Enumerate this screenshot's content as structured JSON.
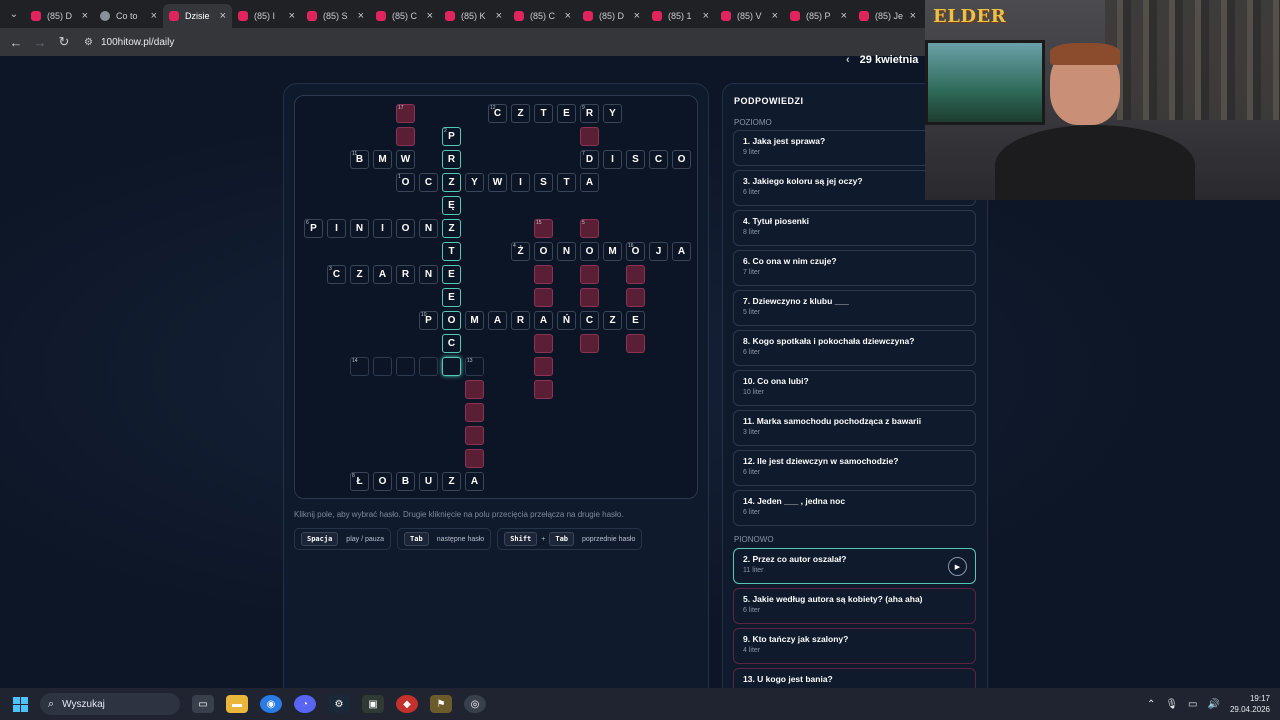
{
  "browser": {
    "tabs": [
      {
        "label": "(85) D",
        "fav": "youtube-icon"
      },
      {
        "label": "Co to",
        "fav": "gear-icon"
      },
      {
        "label": "Dzisie",
        "fav": "active-icon",
        "active": true
      },
      {
        "label": "(85) I",
        "fav": "youtube-icon"
      },
      {
        "label": "(85) S",
        "fav": "youtube-icon"
      },
      {
        "label": "(85) C",
        "fav": "youtube-icon"
      },
      {
        "label": "(85) K",
        "fav": "youtube-icon"
      },
      {
        "label": "(85) C",
        "fav": "youtube-icon"
      },
      {
        "label": "(85) D",
        "fav": "youtube-icon"
      },
      {
        "label": "(85) 1",
        "fav": "youtube-icon"
      },
      {
        "label": "(85) V",
        "fav": "youtube-icon"
      },
      {
        "label": "(85) P",
        "fav": "youtube-icon"
      },
      {
        "label": "(85) Je",
        "fav": "youtube-icon"
      }
    ],
    "url": "100hitow.pl/daily"
  },
  "header": {
    "date": "29 kwietnia",
    "prev_arrow": "‹"
  },
  "grid": {
    "letters": "CZTERY PR BMWR DISCO OCZYWISTA PINIONZ T ŻONOMOJA CZARNE E POMARAŃCZE C ŁOBUZA",
    "cells": [
      {
        "r": 0,
        "c": 4,
        "t": "",
        "red": true,
        "n": "17"
      },
      {
        "r": 0,
        "c": 8,
        "t": "C",
        "n": "12"
      },
      {
        "r": 0,
        "c": 9,
        "t": "Z"
      },
      {
        "r": 0,
        "c": 10,
        "t": "T"
      },
      {
        "r": 0,
        "c": 11,
        "t": "E"
      },
      {
        "r": 0,
        "c": 12,
        "t": "R",
        "n": "9"
      },
      {
        "r": 0,
        "c": 13,
        "t": "Y"
      },
      {
        "r": 1,
        "c": 4,
        "t": "",
        "red": true
      },
      {
        "r": 1,
        "c": 6,
        "t": "P",
        "hl": true,
        "n": "2"
      },
      {
        "r": 1,
        "c": 12,
        "t": "",
        "red": true
      },
      {
        "r": 2,
        "c": 2,
        "t": "B",
        "n": "11"
      },
      {
        "r": 2,
        "c": 3,
        "t": "M"
      },
      {
        "r": 2,
        "c": 4,
        "t": "W"
      },
      {
        "r": 2,
        "c": 6,
        "t": "R",
        "hl": true
      },
      {
        "r": 2,
        "c": 12,
        "t": "D",
        "n": "7"
      },
      {
        "r": 2,
        "c": 13,
        "t": "I"
      },
      {
        "r": 2,
        "c": 14,
        "t": "S"
      },
      {
        "r": 2,
        "c": 15,
        "t": "C"
      },
      {
        "r": 2,
        "c": 16,
        "t": "O"
      },
      {
        "r": 3,
        "c": 4,
        "t": "O",
        "n": "1"
      },
      {
        "r": 3,
        "c": 5,
        "t": "C"
      },
      {
        "r": 3,
        "c": 6,
        "t": "Z",
        "hl": true
      },
      {
        "r": 3,
        "c": 7,
        "t": "Y"
      },
      {
        "r": 3,
        "c": 8,
        "t": "W"
      },
      {
        "r": 3,
        "c": 9,
        "t": "I"
      },
      {
        "r": 3,
        "c": 10,
        "t": "S"
      },
      {
        "r": 3,
        "c": 11,
        "t": "T"
      },
      {
        "r": 3,
        "c": 12,
        "t": "A"
      },
      {
        "r": 4,
        "c": 6,
        "t": "Ę",
        "hl": true
      },
      {
        "r": 5,
        "c": 0,
        "t": "P",
        "n": "6"
      },
      {
        "r": 5,
        "c": 1,
        "t": "I"
      },
      {
        "r": 5,
        "c": 2,
        "t": "N"
      },
      {
        "r": 5,
        "c": 3,
        "t": "I"
      },
      {
        "r": 5,
        "c": 4,
        "t": "O"
      },
      {
        "r": 5,
        "c": 5,
        "t": "N"
      },
      {
        "r": 5,
        "c": 6,
        "t": "Z",
        "hl": true
      },
      {
        "r": 5,
        "c": 10,
        "t": "",
        "red": true,
        "n": "15"
      },
      {
        "r": 5,
        "c": 12,
        "t": "",
        "red": true,
        "n": "5"
      },
      {
        "r": 6,
        "c": 6,
        "t": "T",
        "hl": true
      },
      {
        "r": 6,
        "c": 9,
        "t": "Ż",
        "n": "4"
      },
      {
        "r": 6,
        "c": 10,
        "t": "O"
      },
      {
        "r": 6,
        "c": 11,
        "t": "N"
      },
      {
        "r": 6,
        "c": 12,
        "t": "O"
      },
      {
        "r": 6,
        "c": 13,
        "t": "M"
      },
      {
        "r": 6,
        "c": 14,
        "t": "O",
        "n": "16"
      },
      {
        "r": 6,
        "c": 15,
        "t": "J"
      },
      {
        "r": 6,
        "c": 16,
        "t": "A"
      },
      {
        "r": 7,
        "c": 1,
        "t": "C",
        "n": "3"
      },
      {
        "r": 7,
        "c": 2,
        "t": "Z"
      },
      {
        "r": 7,
        "c": 3,
        "t": "A"
      },
      {
        "r": 7,
        "c": 4,
        "t": "R"
      },
      {
        "r": 7,
        "c": 5,
        "t": "N"
      },
      {
        "r": 7,
        "c": 6,
        "t": "E",
        "hl": true
      },
      {
        "r": 7,
        "c": 10,
        "t": "",
        "red": true
      },
      {
        "r": 7,
        "c": 12,
        "t": "",
        "red": true
      },
      {
        "r": 7,
        "c": 14,
        "t": "",
        "red": true
      },
      {
        "r": 8,
        "c": 6,
        "t": "E",
        "hl": true
      },
      {
        "r": 8,
        "c": 10,
        "t": "",
        "red": true
      },
      {
        "r": 8,
        "c": 12,
        "t": "",
        "red": true
      },
      {
        "r": 8,
        "c": 14,
        "t": "",
        "red": true
      },
      {
        "r": 9,
        "c": 5,
        "t": "P",
        "n": "10"
      },
      {
        "r": 9,
        "c": 6,
        "t": "O",
        "hl": true
      },
      {
        "r": 9,
        "c": 7,
        "t": "M"
      },
      {
        "r": 9,
        "c": 8,
        "t": "A"
      },
      {
        "r": 9,
        "c": 9,
        "t": "R"
      },
      {
        "r": 9,
        "c": 10,
        "t": "A"
      },
      {
        "r": 9,
        "c": 11,
        "t": "Ń"
      },
      {
        "r": 9,
        "c": 12,
        "t": "C"
      },
      {
        "r": 9,
        "c": 13,
        "t": "Z"
      },
      {
        "r": 9,
        "c": 14,
        "t": "E"
      },
      {
        "r": 10,
        "c": 6,
        "t": "C",
        "hl": true
      },
      {
        "r": 10,
        "c": 10,
        "t": "",
        "red": true
      },
      {
        "r": 10,
        "c": 12,
        "t": "",
        "red": true
      },
      {
        "r": 10,
        "c": 14,
        "t": "",
        "red": true
      },
      {
        "r": 11,
        "c": 2,
        "t": "",
        "empty": true,
        "n": "14"
      },
      {
        "r": 11,
        "c": 3,
        "t": "",
        "empty": true
      },
      {
        "r": 11,
        "c": 4,
        "t": "",
        "empty": true
      },
      {
        "r": 11,
        "c": 5,
        "t": "",
        "empty": true
      },
      {
        "r": 11,
        "c": 6,
        "t": "",
        "sel": true
      },
      {
        "r": 11,
        "c": 7,
        "t": "",
        "empty": true,
        "n": "13"
      },
      {
        "r": 11,
        "c": 10,
        "t": "",
        "red": true
      },
      {
        "r": 12,
        "c": 7,
        "t": "",
        "red": true
      },
      {
        "r": 12,
        "c": 10,
        "t": "",
        "red": true
      },
      {
        "r": 13,
        "c": 7,
        "t": "",
        "red": true
      },
      {
        "r": 14,
        "c": 7,
        "t": "",
        "red": true
      },
      {
        "r": 15,
        "c": 7,
        "t": "",
        "red": true
      },
      {
        "r": 16,
        "c": 2,
        "t": "Ł",
        "n": "8"
      },
      {
        "r": 16,
        "c": 3,
        "t": "O"
      },
      {
        "r": 16,
        "c": 4,
        "t": "B"
      },
      {
        "r": 16,
        "c": 5,
        "t": "U"
      },
      {
        "r": 16,
        "c": 6,
        "t": "Z"
      },
      {
        "r": 16,
        "c": 7,
        "t": "A"
      }
    ]
  },
  "hint_text": "Kliknij pole, aby wybrać hasło. Drugie kliknięcie na polu przecięcia przełącza na drugie hasło.",
  "shortcuts": [
    {
      "keys": [
        "Spacja"
      ],
      "label": "play / pauza"
    },
    {
      "keys": [
        "Tab"
      ],
      "label": "następne hasło"
    },
    {
      "keys": [
        "Shift",
        "Tab"
      ],
      "label": "poprzednie hasło"
    }
  ],
  "sidebar": {
    "title": "PODPOWIEDZI",
    "across_label": "POZIOMO",
    "down_label": "PIONOWO",
    "across": [
      {
        "text": "1. Jaka jest sprawa?",
        "len": "9 liter"
      },
      {
        "text": "3. Jakiego koloru są jej oczy?",
        "len": "6 liter"
      },
      {
        "text": "4. Tytuł piosenki",
        "len": "8 liter"
      },
      {
        "text": "6. Co ona w nim czuje?",
        "len": "7 liter"
      },
      {
        "text": "7. Dziewczyno z klubu ___",
        "len": "5 liter"
      },
      {
        "text": "8. Kogo spotkała i pokochała dziewczyna?",
        "len": "6 liter"
      },
      {
        "text": "10. Co ona lubi?",
        "len": "10 liter"
      },
      {
        "text": "11. Marka samochodu pochodząca z bawarii",
        "len": "3 liter"
      },
      {
        "text": "12. Ile jest dziewczyn w samochodzie?",
        "len": "6 liter"
      },
      {
        "text": "14. Jeden ___ , jedna noc",
        "len": "6 liter"
      }
    ],
    "down": [
      {
        "text": "2. Przez co autor oszalał?",
        "len": "11 liter",
        "active": true
      },
      {
        "text": "5. Jakie według autora są kobiety? (aha aha)",
        "len": "6 liter"
      },
      {
        "text": "9. Kto tańczy jak szalony?",
        "len": "4 liter"
      },
      {
        "text": "13. U kogo jest bania?",
        "len": ""
      }
    ]
  },
  "webcam": {
    "logo": "ELDER"
  },
  "taskbar": {
    "search_placeholder": "Wyszukaj",
    "time": "19:17",
    "date": "29.04.2026"
  }
}
